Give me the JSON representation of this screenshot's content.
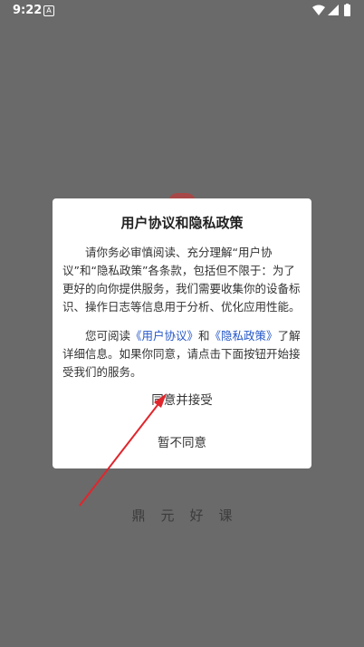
{
  "status_bar": {
    "time": "9:22",
    "notification_icon": "a-notification-icon",
    "wifi_icon": "wifi-icon",
    "signal_icon": "signal-icon",
    "battery_icon": "battery-icon"
  },
  "background": {
    "brand_text": "鼎元好课"
  },
  "dialog": {
    "title": "用户协议和隐私政策",
    "paragraph1": "请你务必审慎阅读、充分理解“用户协议”和“隐私政策”各条款，包括但不限于：为了更好的向你提供服务，我们需要收集你的设备标识、操作日志等信息用于分析、优化应用性能。",
    "paragraph2_prefix": "您可阅读",
    "link_user_agreement": "《用户协议》",
    "paragraph2_and": "和",
    "link_privacy_policy": "《隐私政策》",
    "paragraph2_suffix": "了解详细信息。如果你同意，请点击下面按钮开始接受我们的服务。",
    "agree_button": "同意并接受",
    "disagree_button": "暂不同意"
  },
  "colors": {
    "overlay_bg": "#6a6a6a",
    "dialog_bg": "#ffffff",
    "link": "#2456c7",
    "annotation_arrow": "#e0262c"
  }
}
